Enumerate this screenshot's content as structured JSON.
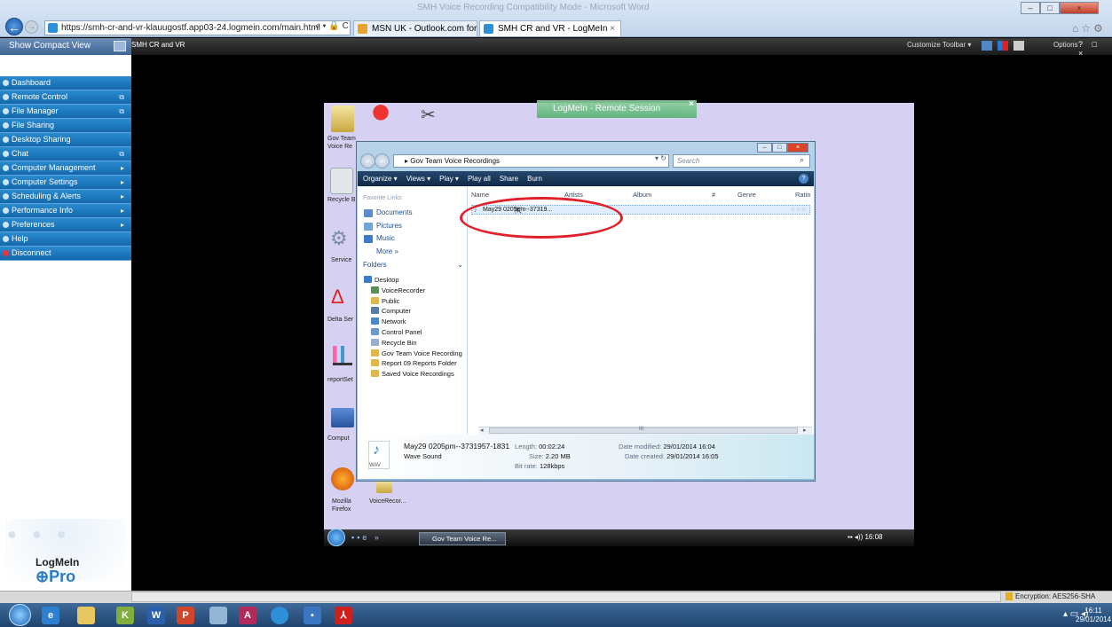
{
  "browser": {
    "url": "https://smh-cr-and-vr-klauugostf.app03-24.logmein.com/main.html",
    "address_controls": "⌕ ▾ 🔒 C",
    "tabs": [
      {
        "label": "MSN UK - Outlook.com forme..."
      },
      {
        "label": "SMH CR and VR - LogMeIn"
      }
    ],
    "window_title": "SMH Voice Recording Compatibility Mode - Microsoft Word",
    "accent": "#1c5aa8"
  },
  "logmein": {
    "compact_view": "Show Compact View",
    "title": "SMH CR and VR",
    "toolbar": {
      "customize": "Customize Toolbar",
      "options": "Options",
      "controls": "? □ ×"
    },
    "menu": [
      {
        "label": "Dashboard",
        "arrow": ""
      },
      {
        "label": "Remote Control",
        "arrow": "⧉"
      },
      {
        "label": "File Manager",
        "arrow": "⧉"
      },
      {
        "label": "File Sharing",
        "arrow": ""
      },
      {
        "label": "Desktop Sharing",
        "arrow": ""
      },
      {
        "label": "Chat",
        "arrow": "⧉"
      },
      {
        "label": "Computer Management",
        "arrow": "▸"
      },
      {
        "label": "Computer Settings",
        "arrow": "▸"
      },
      {
        "label": "Scheduling & Alerts",
        "arrow": "▸"
      },
      {
        "label": "Performance Info",
        "arrow": "▸"
      },
      {
        "label": "Preferences",
        "arrow": "▸"
      },
      {
        "label": "Help",
        "arrow": ""
      },
      {
        "label": "Disconnect",
        "arrow": ""
      }
    ],
    "logo": {
      "name": "LogMeIn",
      "pro": "Pro"
    },
    "session_bar": "LogMeIn - Remote Session",
    "encryption": "Encryption: AES256-SHA",
    "menu_color": "#1467aa"
  },
  "desktop": {
    "icons": [
      {
        "label": "Gov Team Voice Re"
      },
      {
        "label": "Recycle B"
      },
      {
        "label": "Service"
      },
      {
        "label": "Delta Ser"
      },
      {
        "label": "reportSet"
      },
      {
        "label": "Comput"
      },
      {
        "label": "Mozilla Firefox"
      },
      {
        "label": "VoiceRecor..."
      }
    ],
    "background": "#d6d0f2"
  },
  "explorer": {
    "breadcrumb": "▸ Gov Team Voice Recordings",
    "search_placeholder": "Search",
    "commands": [
      "Organize ▾",
      "Views ▾",
      "Play ▾",
      "Play all",
      "Share",
      "Burn"
    ],
    "favorite_links_label": "Favorite Links",
    "favorite_links": [
      "Documents",
      "Pictures",
      "Music",
      "More »"
    ],
    "folders_label": "Folders",
    "folder_tree": [
      "Desktop",
      "VoiceRecorder",
      "Public",
      "Computer",
      "Network",
      "Control Panel",
      "Recycle Bin",
      "Gov Team Voice Recording",
      "Report 09 Reports Folder",
      "Saved Voice Recordings"
    ],
    "columns": [
      "Name",
      "Artists",
      "Album",
      "#",
      "Genre",
      "Ratin"
    ],
    "files": [
      {
        "name": "May29 0205pm--37319...",
        "rating": "☆☆☆"
      }
    ],
    "scroll_grip": "III",
    "details": {
      "filename": "May29 0205pm--3731957-1831",
      "type": "Wave Sound",
      "length_label": "Length:",
      "length": "00:02:24",
      "size_label": "Size:",
      "size": "2.20 MB",
      "bitrate_label": "Bit rate:",
      "bitrate": "128kbps",
      "modified_label": "Date modified:",
      "modified": "29/01/2014 16:04",
      "created_label": "Date created:",
      "created": "29/01/2014 16:05",
      "icon_label": "WAV"
    }
  },
  "remote_taskbar": {
    "active_window": "Gov Team Voice Re...",
    "clock": "16:08"
  },
  "taskbar": {
    "time": "16:11",
    "date": "29/01/2014"
  }
}
